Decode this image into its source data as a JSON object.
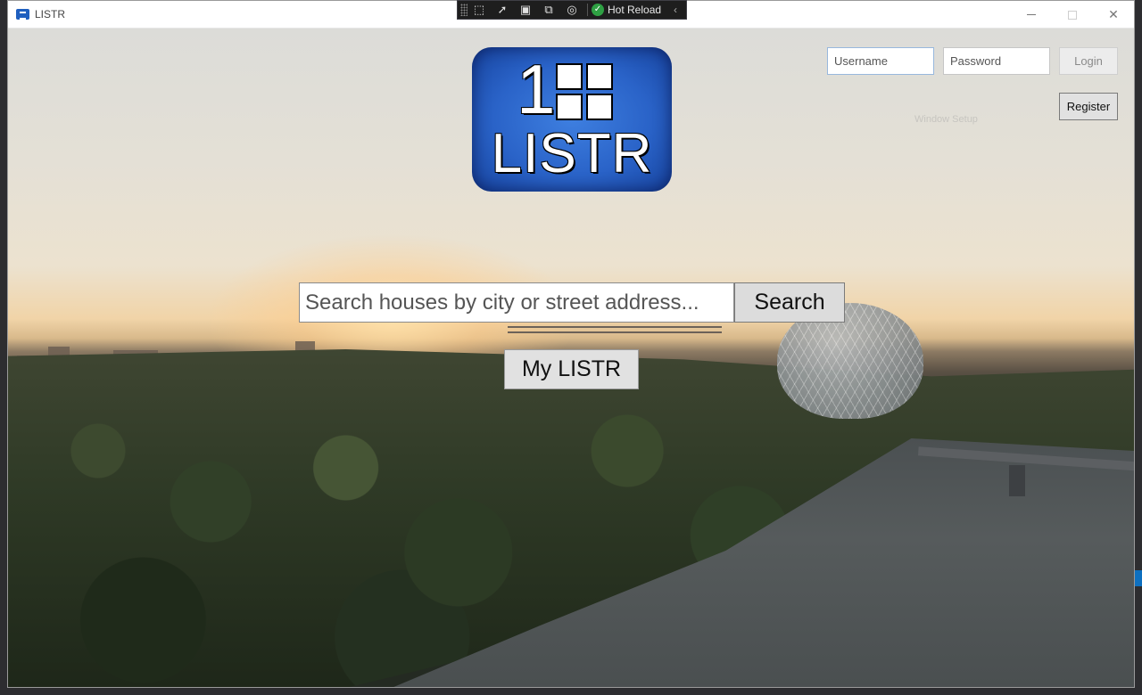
{
  "window": {
    "title": "LISTR",
    "controls": {
      "minimize": "minimize-icon",
      "maximize": "maximize-icon",
      "close": "close-icon"
    }
  },
  "devbar": {
    "tools": [
      "select-element-icon",
      "pointer-icon",
      "layout-adorner-icon",
      "display-layout-icon",
      "track-focus-icon"
    ],
    "hot_reload_label": "Hot Reload",
    "status_icon": "check-circle-icon",
    "collapse_icon": "chevron-left-icon"
  },
  "logo": {
    "number": "1",
    "text": "LISTR",
    "color": "#2a63c8"
  },
  "login": {
    "username_placeholder": "Username",
    "password_placeholder": "Password",
    "login_label": "Login",
    "register_label": "Register"
  },
  "ghost_text": "Window Setup",
  "search": {
    "placeholder": "Search houses by city or street address...",
    "button_label": "Search"
  },
  "my_listr_label": "My LISTR"
}
